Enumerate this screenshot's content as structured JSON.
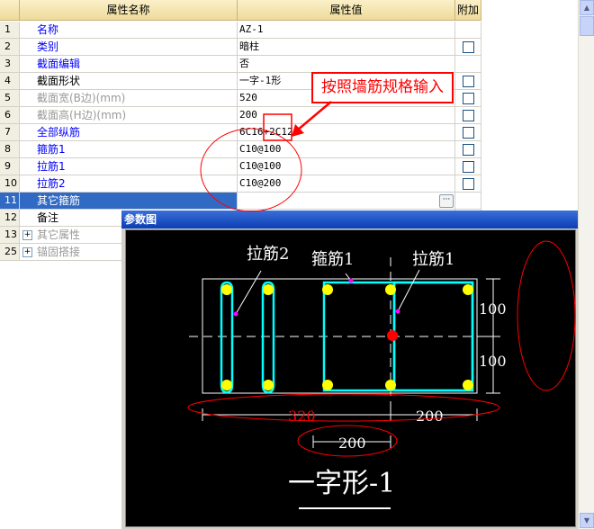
{
  "grid": {
    "headers": {
      "name": "属性名称",
      "value": "属性值",
      "extra": "附加"
    },
    "rows": [
      {
        "num": "1",
        "name": "名称",
        "value": "AZ-1",
        "color": "blue",
        "checkbox": false
      },
      {
        "num": "2",
        "name": "类别",
        "value": "暗柱",
        "color": "blue",
        "checkbox": true
      },
      {
        "num": "3",
        "name": "截面编辑",
        "value": "否",
        "color": "blue",
        "checkbox": false
      },
      {
        "num": "4",
        "name": "截面形状",
        "value": "一字-1形",
        "color": "black",
        "checkbox": true
      },
      {
        "num": "5",
        "name": "截面宽(B边)(mm)",
        "value": "520",
        "color": "grey",
        "checkbox": true
      },
      {
        "num": "6",
        "name": "截面高(H边)(mm)",
        "value": "200",
        "color": "grey",
        "checkbox": true
      },
      {
        "num": "7",
        "name": "全部纵筋",
        "value": "6C16+2C12",
        "color": "blue",
        "checkbox": true
      },
      {
        "num": "8",
        "name": "箍筋1",
        "value": "C10@100",
        "color": "blue",
        "checkbox": true
      },
      {
        "num": "9",
        "name": "拉筋1",
        "value": "C10@100",
        "color": "blue",
        "checkbox": true
      },
      {
        "num": "10",
        "name": "拉筋2",
        "value": "C10@200",
        "color": "blue",
        "checkbox": true
      },
      {
        "num": "11",
        "name": "其它箍筋",
        "value": "",
        "color": "white",
        "checkbox": false,
        "selected": true,
        "ellipsis": true
      },
      {
        "num": "12",
        "name": "备注",
        "value": "",
        "color": "black",
        "checkbox": false
      },
      {
        "num": "13",
        "name": "其它属性",
        "value": "",
        "color": "grey",
        "checkbox": false,
        "expander": "+"
      },
      {
        "num": "25",
        "name": "锚固搭接",
        "value": "",
        "color": "grey",
        "checkbox": false,
        "expander": "+"
      }
    ]
  },
  "callout": {
    "text": "按照墙筋规格输入"
  },
  "panel": {
    "title": "参数图",
    "labels": {
      "tie2": "拉筋2",
      "stirrup1": "箍筋1",
      "tie1": "拉筋1",
      "dim_100_top": "100",
      "dim_100_bottom": "100",
      "dim_320": "320",
      "dim_200_right": "200",
      "dim_200_bottom": "200",
      "shape_name": "一字形-1"
    },
    "colors": {
      "rebar": "#ffff00",
      "stirrup": "#00ffff",
      "marker": "#ff00ff",
      "center": "#ff0000",
      "dim_highlight": "#ff0000"
    }
  },
  "icons": {
    "scroll_up": "scroll-up-arrow-icon",
    "scroll_down": "scroll-down-arrow-icon",
    "expander": "plus-box-icon",
    "more": "ellipsis-icon"
  }
}
